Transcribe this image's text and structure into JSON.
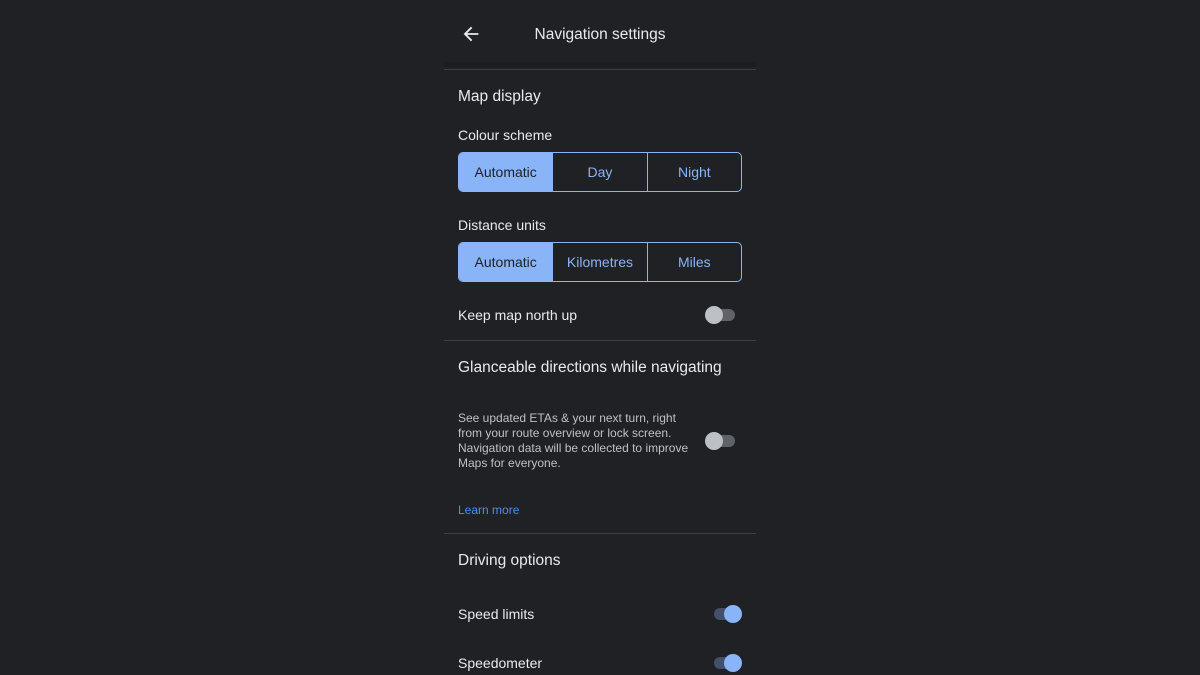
{
  "header": {
    "back_icon": "arrow-left-icon",
    "title": "Navigation settings"
  },
  "map_display": {
    "title": "Map display",
    "colour_scheme": {
      "label": "Colour scheme",
      "options": [
        "Automatic",
        "Day",
        "Night"
      ],
      "selected": "Automatic"
    },
    "distance_units": {
      "label": "Distance units",
      "options": [
        "Automatic",
        "Kilometres",
        "Miles"
      ],
      "selected": "Automatic"
    },
    "north_up": {
      "label": "Keep map north up",
      "enabled": false
    }
  },
  "glanceable": {
    "title": "Glanceable directions while navigating",
    "description": "See updated ETAs & your next turn, right from your route overview or lock screen. Navigation data will be collected to improve Maps for everyone.",
    "enabled": false,
    "learn_more": "Learn more"
  },
  "driving_options": {
    "title": "Driving options",
    "items": [
      {
        "label": "Speed limits",
        "enabled": true
      },
      {
        "label": "Speedometer",
        "enabled": true
      }
    ]
  },
  "colors": {
    "background": "#202124",
    "accent": "#8ab4f8",
    "link": "#4a8ff0"
  }
}
